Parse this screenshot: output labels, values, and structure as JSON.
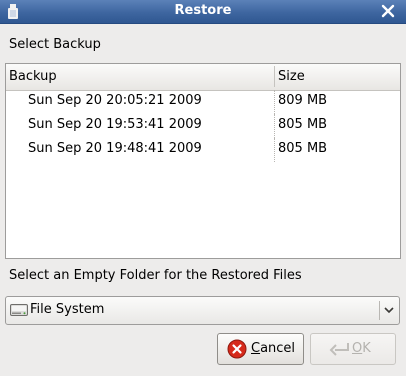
{
  "window": {
    "title": "Restore"
  },
  "sections": {
    "select_backup": "Select Backup",
    "select_folder": "Select an Empty Folder for the Restored Files"
  },
  "table": {
    "columns": [
      "Backup",
      "Size"
    ],
    "rows": [
      {
        "date": "Sun Sep 20 20:05:21 2009",
        "size": "809 MB"
      },
      {
        "date": "Sun Sep 20 19:53:41 2009",
        "size": "805 MB"
      },
      {
        "date": "Sun Sep 20 19:48:41 2009",
        "size": "805 MB"
      }
    ]
  },
  "folder_combo": {
    "selected": "File System",
    "icon": "drive-icon"
  },
  "buttons": {
    "cancel": {
      "mnemonic": "C",
      "rest": "ancel",
      "icon": "cancel-icon",
      "enabled": true
    },
    "ok": {
      "mnemonic": "O",
      "rest": "K",
      "icon": "ok-icon",
      "enabled": false
    }
  },
  "colors": {
    "titlebar": "#3e66a0",
    "title_text": "#ffffff",
    "window_bg": "#edeceb",
    "cancel_icon": "#d62a1a",
    "disabled_text": "#b4b2ae"
  }
}
